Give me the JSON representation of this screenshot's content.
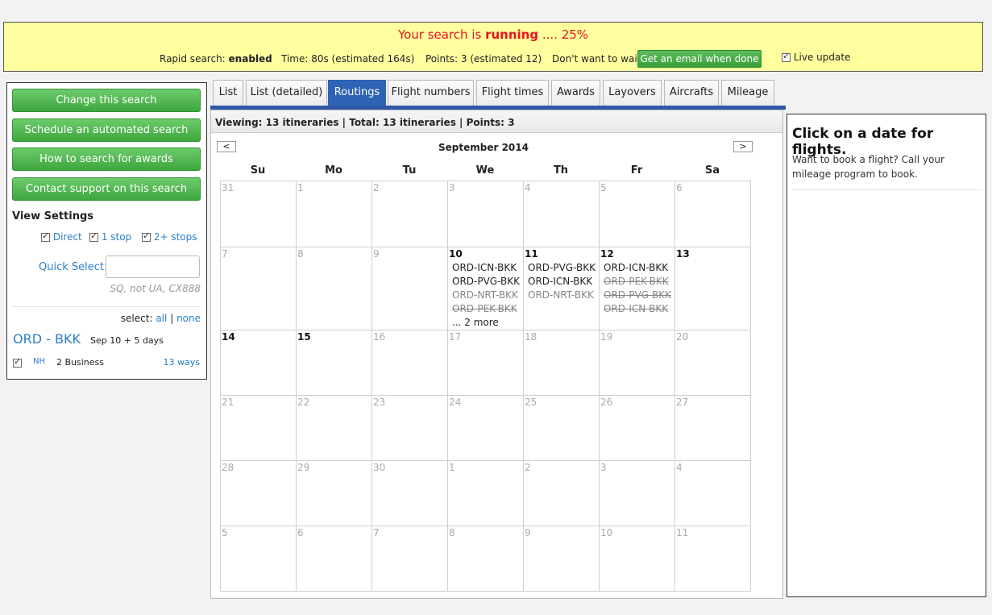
{
  "status": {
    "prefix": "Your search is",
    "state": "running",
    "progress": ".... 25%",
    "progress_value": 0.25,
    "rapid_label": "Rapid search:",
    "rapid_value": "enabled",
    "time": "Time: 80s (estimated 164s)",
    "points": "Points: 3 (estimated 12)",
    "wait": "Don't want to wait?",
    "email_button": "Get an email when done",
    "live_update": "Live update"
  },
  "left": {
    "buttons": [
      "Change this search",
      "Schedule an automated search",
      "How to search for awards",
      "Contact support on this search"
    ],
    "view_settings": "View Settings",
    "filters": [
      "Direct",
      "1 stop",
      "2+ stops"
    ],
    "quick_select_label": "Quick Select:",
    "quick_select_value": "",
    "quick_hint": "SQ, not UA, CX888",
    "select_label": "select:",
    "select_all": "all",
    "select_sep": "|",
    "select_none": "none",
    "route": "ORD - BKK",
    "route_dates": "Sep 10 + 5 days",
    "airline_code": "NH",
    "airline_class": "2 Business",
    "airline_ways": "13 ways"
  },
  "tabs": [
    "List",
    "List (detailed)",
    "Routings",
    "Flight numbers",
    "Flight times",
    "Awards",
    "Layovers",
    "Aircrafts",
    "Mileage"
  ],
  "active_tab": "Routings",
  "calendar": {
    "viewing": "Viewing: 13 itineraries | Total: 13 itineraries | Points: 3",
    "month": "September 2014",
    "prev": "<",
    "next": ">",
    "days": [
      "Su",
      "Mo",
      "Tu",
      "We",
      "Th",
      "Fr",
      "Sa"
    ],
    "weeks": [
      [
        {
          "d": "31"
        },
        {
          "d": "1"
        },
        {
          "d": "2"
        },
        {
          "d": "3"
        },
        {
          "d": "4"
        },
        {
          "d": "5"
        },
        {
          "d": "6"
        }
      ],
      [
        {
          "d": "7"
        },
        {
          "d": "8"
        },
        {
          "d": "9"
        },
        {
          "d": "10",
          "cur": true,
          "routes": [
            {
              "t": "ORD-ICN-BKK"
            },
            {
              "t": "ORD-PVG-BKK"
            },
            {
              "t": "ORD-NRT-BKK",
              "style": "gray"
            },
            {
              "t": "ORD-PEK-BKK",
              "style": "strike"
            },
            {
              "t": "... 2 more"
            }
          ]
        },
        {
          "d": "11",
          "cur": true,
          "routes": [
            {
              "t": "ORD-PVG-BKK"
            },
            {
              "t": "ORD-ICN-BKK"
            },
            {
              "t": "ORD-NRT-BKK",
              "style": "gray"
            }
          ]
        },
        {
          "d": "12",
          "cur": true,
          "routes": [
            {
              "t": "ORD-ICN-BKK"
            },
            {
              "t": "ORD-PEK-BKK",
              "style": "strike"
            },
            {
              "t": "ORD-PVG-BKK",
              "style": "strike"
            },
            {
              "t": "ORD-ICN-BKK",
              "style": "strike"
            }
          ]
        },
        {
          "d": "13",
          "cur": true
        }
      ],
      [
        {
          "d": "14",
          "cur": true
        },
        {
          "d": "15",
          "cur": true
        },
        {
          "d": "16"
        },
        {
          "d": "17"
        },
        {
          "d": "18"
        },
        {
          "d": "19"
        },
        {
          "d": "20"
        }
      ],
      [
        {
          "d": "21"
        },
        {
          "d": "22"
        },
        {
          "d": "23"
        },
        {
          "d": "24"
        },
        {
          "d": "25"
        },
        {
          "d": "26"
        },
        {
          "d": "27"
        }
      ],
      [
        {
          "d": "28"
        },
        {
          "d": "29"
        },
        {
          "d": "30"
        },
        {
          "d": "1"
        },
        {
          "d": "2"
        },
        {
          "d": "3"
        },
        {
          "d": "4"
        }
      ],
      [
        {
          "d": "5"
        },
        {
          "d": "6"
        },
        {
          "d": "7"
        },
        {
          "d": "8"
        },
        {
          "d": "9"
        },
        {
          "d": "10"
        },
        {
          "d": "11"
        }
      ]
    ]
  },
  "right": {
    "title": "Click on a date for flights.",
    "text": "Want to book a flight? Call your mileage program to book."
  },
  "colors": {
    "accent_blue": "#2f63b5",
    "green": "#3ea63e",
    "banner": "#ffffa0",
    "running_red": "#e8121c"
  }
}
